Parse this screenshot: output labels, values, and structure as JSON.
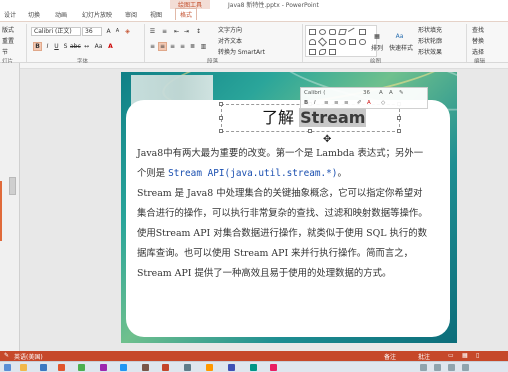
{
  "window": {
    "title": "Java8 新特性.pptx - PowerPoint",
    "context_tab": "绘图工具"
  },
  "tabs": [
    "设计",
    "切换",
    "动画",
    "幻灯片放映",
    "审阅",
    "视图",
    "格式"
  ],
  "active_tab": "格式",
  "ribbon": {
    "layout_label": "版式",
    "reset_label": "重置",
    "section_label": "节",
    "font_name": "Calibri (正文)",
    "font_size": "36",
    "group_font": "字体",
    "group_paragraph": "段落",
    "group_drawing": "绘图",
    "group_editing": "编辑",
    "group_slides": "灯片",
    "text_direction": "文字方向",
    "align_text": "对齐文本",
    "convert_smartart": "转换为 SmartArt",
    "arrange": "排列",
    "quick_styles": "快速样式",
    "shape_fill": "形状填充",
    "shape_outline": "形状轮廓",
    "shape_effects": "形状效果",
    "find": "查找",
    "replace": "替换",
    "select": "选择"
  },
  "mini_toolbar": {
    "font": "Calibri (",
    "size": "36"
  },
  "slide": {
    "title_plain": "了解 ",
    "title_highlight": "Stream",
    "line1": "Java8中有两大最为重要的改变。第一个是 Lambda 表达式；另外一",
    "line2_pre": "个则是 ",
    "line2_code": "Stream API(java.util.stream.*)",
    "line2_post": "。",
    "line3": "Stream 是 Java8 中处理集合的关键抽象概念，它可以指定你希望对",
    "line4": "集合进行的操作，可以执行非常复杂的查找、过滤和映射数据等操作。",
    "line5": "使用Stream API 对集合数据进行操作，就类似于使用 SQL 执行的数",
    "line6": "据库查询。也可以使用 Stream API 来并行执行操作。简而言之，",
    "line7": "Stream API 提供了一种高效且易于使用的处理数据的方式。"
  },
  "status": {
    "language": "英语(美国)",
    "notes": "备注",
    "comments": "批注"
  }
}
